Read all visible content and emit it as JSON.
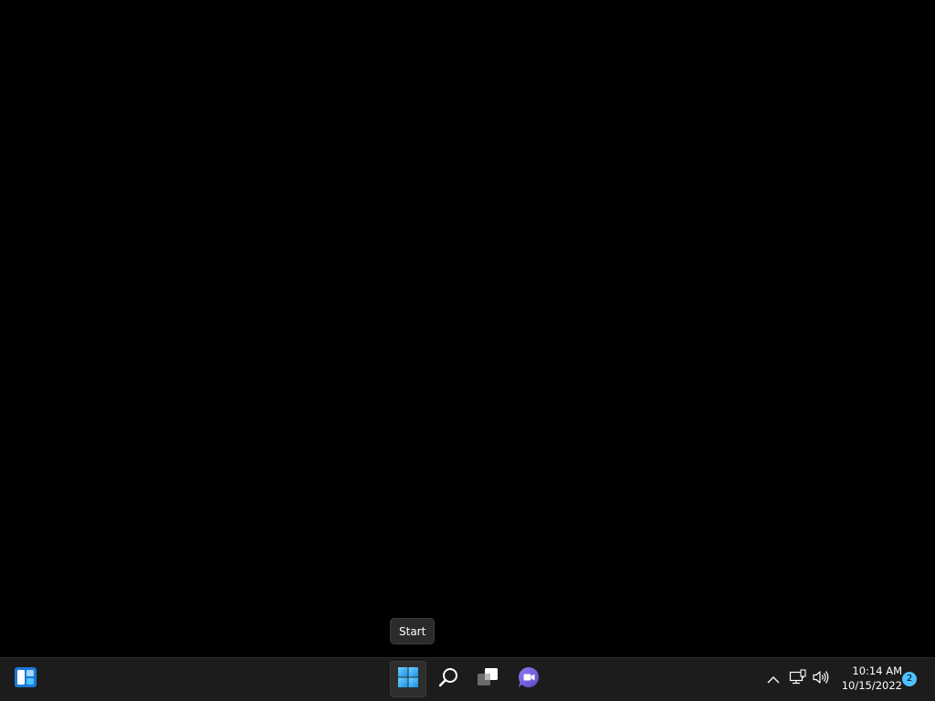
{
  "desktop": {
    "background_color": "#000000"
  },
  "taskbar": {
    "background_color": "#1c1c1c",
    "start_tooltip": "Start",
    "items": [
      {
        "name": "widgets",
        "icon": "widgets-icon"
      },
      {
        "name": "start",
        "icon": "windows-logo-icon",
        "active": true
      },
      {
        "name": "search",
        "icon": "search-icon"
      },
      {
        "name": "task-view",
        "icon": "task-view-icon"
      },
      {
        "name": "chat",
        "icon": "teams-chat-icon"
      }
    ]
  },
  "system_tray": {
    "icons": [
      "chevron-up-icon",
      "network-icon",
      "volume-icon"
    ],
    "time": "10:14 AM",
    "date": "10/15/2022",
    "notification_count": "2",
    "accent_color": "#4cc2ff"
  }
}
